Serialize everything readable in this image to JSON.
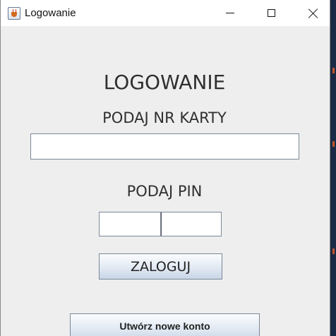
{
  "window": {
    "title": "Logowanie",
    "icon": "java-cup-icon"
  },
  "form": {
    "heading": "LOGOWANIE",
    "card_label": "PODAJ NR KARTY",
    "card_value": "",
    "pin_label": "PODAJ PIN",
    "pin_part1": "",
    "pin_part2": "",
    "login_button": "ZALOGUJ",
    "create_account_button": "Utwórz nowe konto"
  },
  "colors": {
    "window_bg": "#eeeeee",
    "button_gradient_top": "#fbfcfe",
    "button_gradient_bottom": "#c9d6e6",
    "desktop_bg": "#1b2a44"
  }
}
